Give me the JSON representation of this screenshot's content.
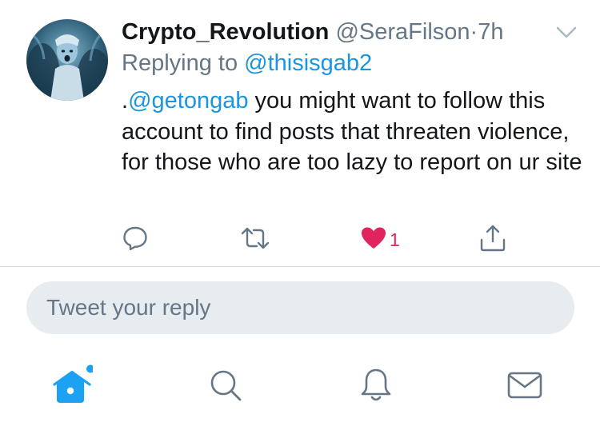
{
  "tweet": {
    "display_name": "Crypto_Revolution",
    "handle": "@SeraFilson",
    "separator": "·",
    "time": "7h",
    "replying_prefix": "Replying to ",
    "replying_to": "@thisisgab2",
    "text_prefix": ".",
    "mention": "@getongab",
    "text_rest": " you might want to follow this account to find posts that threaten violence, for those who are too lazy to report on ur site",
    "like_count": "1",
    "liked": true
  },
  "reply": {
    "placeholder": "Tweet your reply"
  },
  "tabbar": {
    "items": [
      {
        "icon": "home-icon",
        "active": true,
        "notification_dot": true
      },
      {
        "icon": "search-icon",
        "active": false
      },
      {
        "icon": "bell-icon",
        "active": false
      },
      {
        "icon": "mail-icon",
        "active": false
      }
    ]
  },
  "colors": {
    "link": "#1b95e0",
    "secondary_text": "#657786",
    "like": "#e0245e",
    "active_tab": "#1da1f2",
    "inactive_icon": "#657786",
    "input_bg": "#e6ecf0"
  }
}
